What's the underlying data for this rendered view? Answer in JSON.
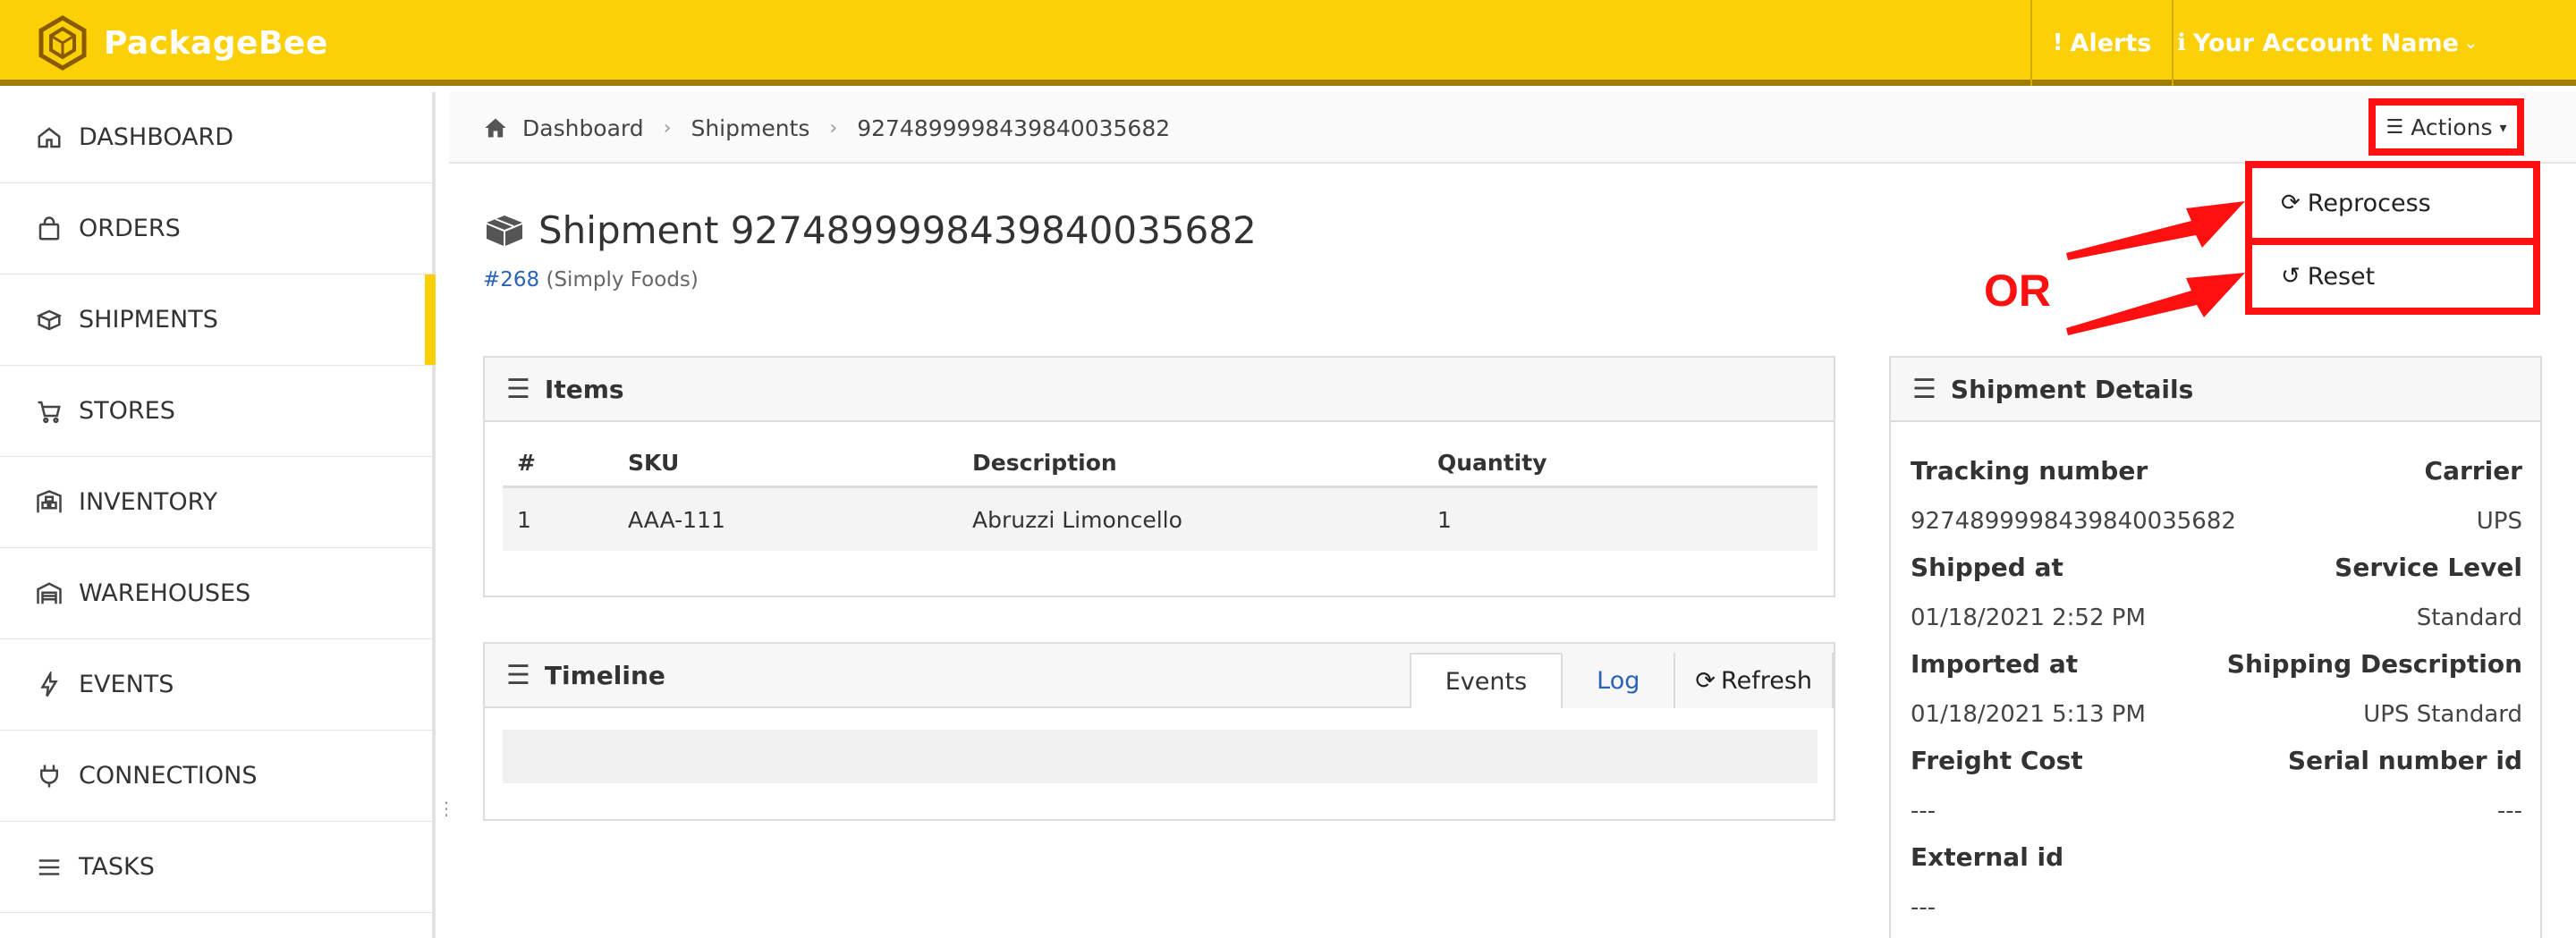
{
  "brand": {
    "name": "PackageBee",
    "accent": "#fcd006"
  },
  "topnav": {
    "alerts": "Alerts",
    "account": "Your Account Name"
  },
  "sidebar": {
    "items": [
      {
        "label": "DASHBOARD",
        "icon": "home-icon"
      },
      {
        "label": "ORDERS",
        "icon": "bag-icon"
      },
      {
        "label": "SHIPMENTS",
        "icon": "boxes-icon",
        "active": true
      },
      {
        "label": "STORES",
        "icon": "cart-icon"
      },
      {
        "label": "INVENTORY",
        "icon": "inventory-icon"
      },
      {
        "label": "WAREHOUSES",
        "icon": "warehouse-icon"
      },
      {
        "label": "EVENTS",
        "icon": "bolt-icon"
      },
      {
        "label": "CONNECTIONS",
        "icon": "plug-icon"
      },
      {
        "label": "TASKS",
        "icon": "list-icon"
      }
    ]
  },
  "breadcrumb": [
    "Dashboard",
    "Shipments",
    "9274899998439840035682"
  ],
  "actions": {
    "label": "Actions",
    "menu": [
      "Reprocess",
      "Reset"
    ],
    "annotation": "OR",
    "highlight_color": "#ff1010"
  },
  "page": {
    "title": "Shipment 9274899998439840035682",
    "order_link": "#268",
    "store": "(Simply Foods)"
  },
  "items_panel": {
    "title": "Items",
    "columns": [
      "#",
      "SKU",
      "Description",
      "Quantity"
    ],
    "rows": [
      [
        "1",
        "AAA-111",
        "Abruzzi Limoncello",
        "1"
      ]
    ]
  },
  "timeline": {
    "title": "Timeline",
    "tabs": [
      "Events",
      "Log"
    ],
    "refresh": "Refresh"
  },
  "details": {
    "title": "Shipment Details",
    "pairs": [
      {
        "left_label": "Tracking number",
        "right_label": "Carrier",
        "left_value": "9274899998439840035682",
        "right_value": "UPS"
      },
      {
        "left_label": "Shipped at",
        "right_label": "Service Level",
        "left_value": "01/18/2021 2:52 PM",
        "right_value": "Standard"
      },
      {
        "left_label": "Imported at",
        "right_label": "Shipping Description",
        "left_value": "01/18/2021 5:13 PM",
        "right_value": "UPS Standard"
      },
      {
        "left_label": "Freight Cost",
        "right_label": "Serial number id",
        "left_value": "---",
        "right_value": "---"
      },
      {
        "left_label": "External id",
        "right_label": "",
        "left_value": "---",
        "right_value": ""
      }
    ]
  }
}
